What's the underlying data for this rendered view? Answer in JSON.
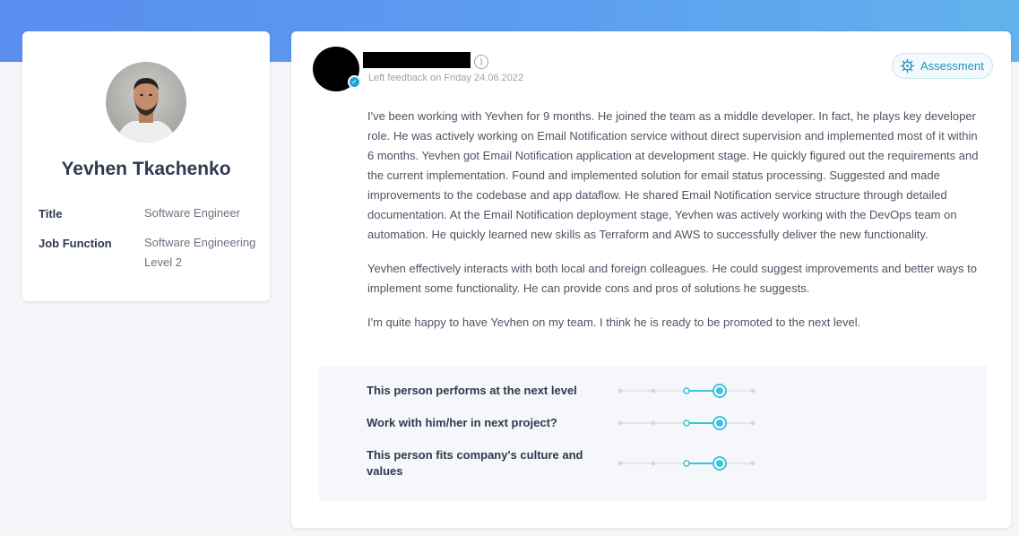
{
  "profile": {
    "name": "Yevhen Tkachenko",
    "title_label": "Title",
    "title_value": "Software Engineer",
    "job_function_label": "Job Function",
    "job_function_value": "Software Engineering Level 2"
  },
  "feedback": {
    "date_text": "Left feedback on Friday 24.06.2022",
    "assessment_label": "Assessment",
    "paragraphs": [
      "I've been working with Yevhen for 9 months. He joined the team as a middle developer. In fact, he plays key developer role. He was actively working on Email Notification service without direct supervision and implemented most of it within 6 months. Yevhen got Email Notification application at development stage. He quickly figured out the requirements and the current implementation. Found and implemented solution for email status processing. Suggested and made improvements to the codebase and app dataflow. He shared Email Notification service structure through detailed documentation. At the Email Notification deployment stage, Yevhen was actively working with the DevOps team on automation. He quickly learned new skills as Terraform and AWS to successfully deliver the new functionality.",
      "Yevhen effectively interacts with both local and foreign colleagues. He could suggest improvements and better ways to implement some functionality. He can provide cons and pros of solutions he suggests.",
      "I'm quite happy to have Yevhen on my team. I think he is ready to be promoted to the next level."
    ]
  },
  "ratings": [
    {
      "label": "This person performs at the next level",
      "value": 4,
      "max": 5
    },
    {
      "label": "Work with him/her in next project?",
      "value": 4,
      "max": 5
    },
    {
      "label": "This person fits company's culture and values",
      "value": 4,
      "max": 5
    }
  ],
  "colors": {
    "accent": "#3fc3dc",
    "header_band": "#5a8def"
  },
  "icons": {
    "info": "info-icon",
    "assessment": "compass-icon",
    "verified": "check-badge-icon"
  }
}
